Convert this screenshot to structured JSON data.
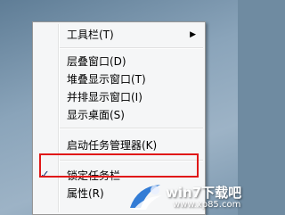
{
  "context_menu": {
    "items": [
      {
        "label": "工具栏(T)",
        "submenu": true
      },
      {
        "label": "层叠窗口(D)"
      },
      {
        "label": "堆叠显示窗口(T)"
      },
      {
        "label": "并排显示窗口(I)"
      },
      {
        "label": "显示桌面(S)"
      },
      {
        "label": "启动任务管理器(K)"
      },
      {
        "label": "锁定任务栏",
        "checked": true
      },
      {
        "label": "属性(R)"
      }
    ],
    "submenu_arrow": "▶",
    "check_mark": "✓"
  },
  "highlight_color": "#e01818",
  "watermark": {
    "brand": "win7下载吧",
    "url": "www.xp85.com"
  }
}
